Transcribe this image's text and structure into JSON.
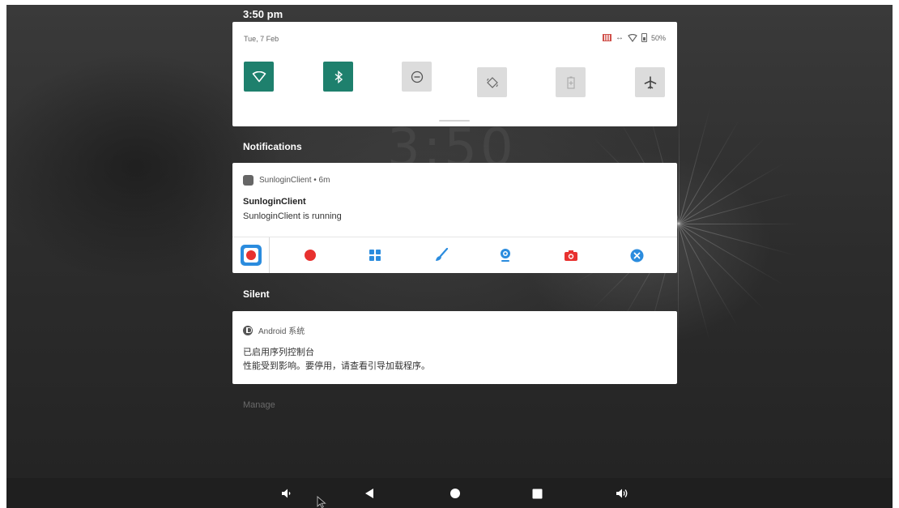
{
  "status_bar": {
    "time": "3:50 pm"
  },
  "quick_settings": {
    "date": "Tue, 7 Feb",
    "battery": "50%",
    "tiles": [
      {
        "name": "wifi",
        "active": true
      },
      {
        "name": "bluetooth",
        "active": true
      },
      {
        "name": "do-not-disturb",
        "active": false
      },
      {
        "name": "auto-rotate",
        "active": false
      },
      {
        "name": "battery-saver",
        "active": false
      },
      {
        "name": "airplane-mode",
        "active": false
      }
    ]
  },
  "sections": {
    "notifications": "Notifications",
    "silent": "Silent"
  },
  "sunlogin_notification": {
    "app_line": "SunloginClient • 6m",
    "title": "SunloginClient",
    "text": "SunloginClient is running",
    "actions": [
      "record-app-icon",
      "record-dot-icon",
      "apps-grid-icon",
      "brush-icon",
      "webcam-icon",
      "camera-icon",
      "close-circle-icon"
    ]
  },
  "android_notification": {
    "app_name": "Android 系统",
    "title": "已启用序列控制台",
    "text": "性能受到影响。要停用，请查看引导加载程序。"
  },
  "manage": {
    "label": "Manage"
  },
  "colors": {
    "tile_active": "#1e806d",
    "tile_inactive": "#dcdcdc",
    "accent_blue": "#2b8cde",
    "accent_red": "#e8312f"
  }
}
